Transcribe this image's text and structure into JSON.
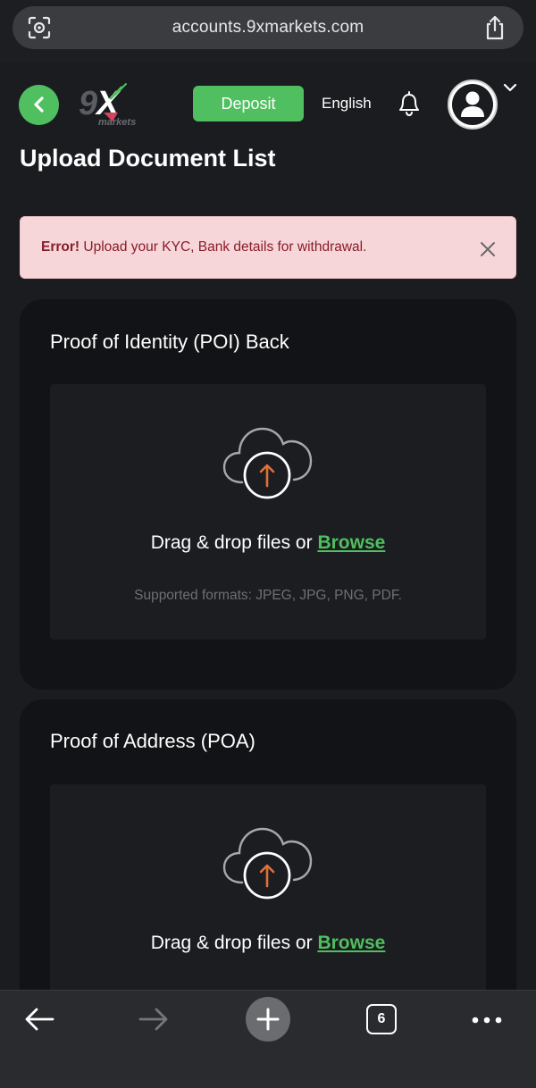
{
  "browser": {
    "url": "accounts.9xmarkets.com",
    "tab_count": "6"
  },
  "header": {
    "logo_text": "9X markets",
    "deposit_label": "Deposit",
    "language": "English"
  },
  "page": {
    "title": "Upload Document List"
  },
  "alert": {
    "strong": "Error!",
    "message": " Upload your KYC, Bank details for withdrawal."
  },
  "cards": [
    {
      "title": "Proof of Identity (POI) Back",
      "dropzone_text": "Drag & drop files or ",
      "browse_label": "Browse",
      "formats": "Supported formats: JPEG, JPG, PNG, PDF."
    },
    {
      "title": "Proof of Address (POA)",
      "dropzone_text": "Drag & drop files or ",
      "browse_label": "Browse"
    }
  ],
  "colors": {
    "accent_green": "#4fbf5f",
    "upload_arrow": "#e0703a",
    "alert_bg": "#f6d6d9",
    "alert_text": "#8a1c2a"
  },
  "icons": {
    "url_left": "screen-capture-icon",
    "url_right": "share-icon",
    "back": "chevron-left-icon",
    "bell": "bell-icon",
    "avatar": "user-icon",
    "chevron": "chevron-down-icon",
    "close": "close-icon",
    "upload": "cloud-upload-icon"
  }
}
